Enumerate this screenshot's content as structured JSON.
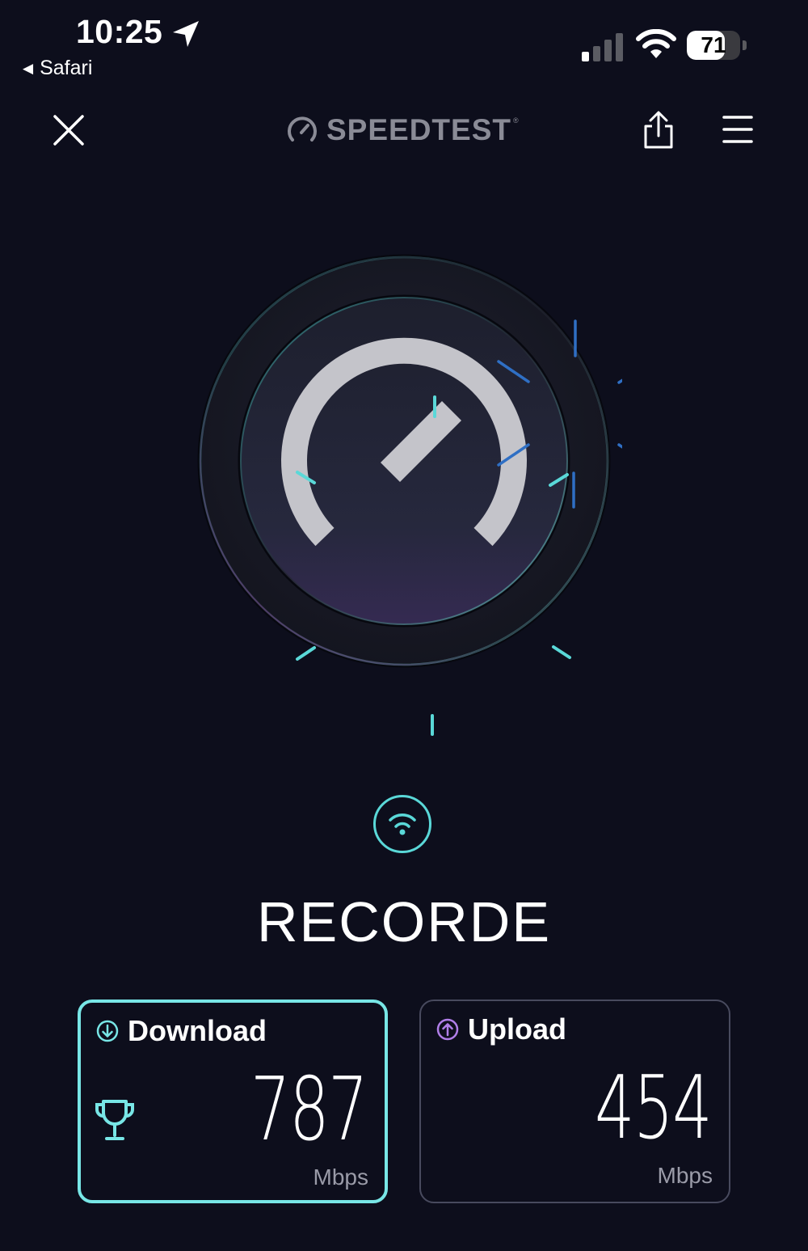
{
  "status_bar": {
    "time": "10:25",
    "back_app": "Safari",
    "battery": "71",
    "battery_level": 0.71
  },
  "app_bar": {
    "logo": "SPEEDTEST",
    "logo_mark": "®",
    "icons": [
      "close-icon",
      "speedtest-logo-icon",
      "share-icon",
      "menu-icon"
    ]
  },
  "connection": {
    "icon": "wifi-icon",
    "provider": "RECORDE"
  },
  "results": {
    "download": {
      "label": "Download",
      "value": "787",
      "unit": "Mbps",
      "icon": "arrow-down-circle-icon",
      "badge": "trophy-icon"
    },
    "upload": {
      "label": "Upload",
      "value": "454",
      "unit": "Mbps",
      "icon": "arrow-up-circle-icon"
    }
  },
  "colors": {
    "background": "#0d0e1c",
    "accent_teal": "#78e6e6",
    "accent_blue": "#2f6fc4",
    "accent_purple": "#b07ee8",
    "gauge_gray": "#c4c4ca"
  }
}
